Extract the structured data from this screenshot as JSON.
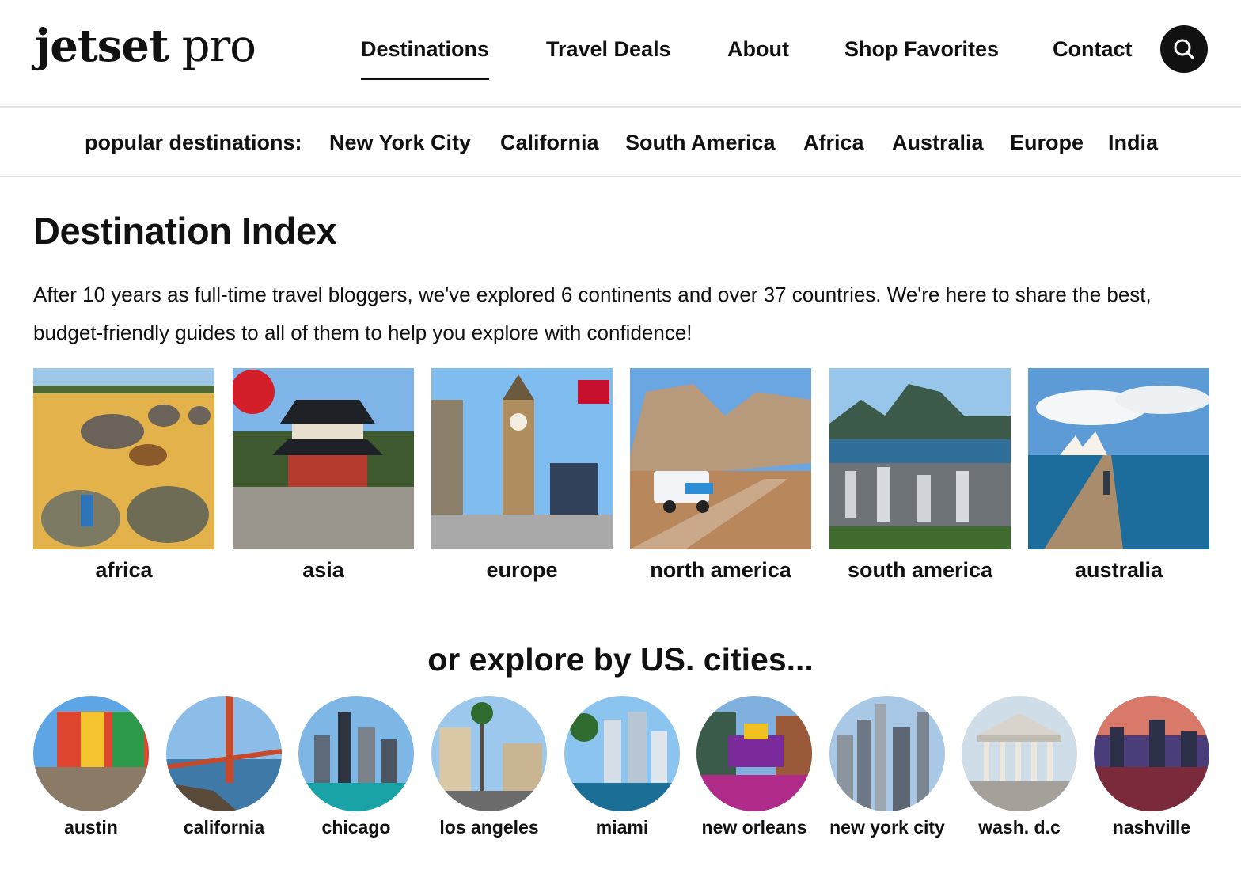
{
  "logo": {
    "part1": "jetset",
    "part2": "pro"
  },
  "nav": {
    "items": [
      {
        "label": "Destinations",
        "active": true
      },
      {
        "label": "Travel Deals"
      },
      {
        "label": "About"
      },
      {
        "label": "Shop Favorites"
      },
      {
        "label": "Contact"
      }
    ],
    "search_icon": "search-icon"
  },
  "popular": {
    "label": "popular destinations:",
    "links": [
      "New York City",
      "California",
      "South America",
      "Africa",
      "Australia",
      "Europe",
      "India"
    ]
  },
  "main": {
    "title": "Destination Index",
    "intro": "After 10 years as full-time travel bloggers, we've explored 6 continents and over 37 countries. We're here to share the best, budget-friendly guides to all of them to help you explore with confidence!",
    "continents": [
      {
        "label": "africa"
      },
      {
        "label": "asia"
      },
      {
        "label": "europe"
      },
      {
        "label": "north america"
      },
      {
        "label": "south america"
      },
      {
        "label": "australia"
      }
    ],
    "cities_title": "or explore by US. cities...",
    "cities": [
      {
        "label": "austin"
      },
      {
        "label": "california"
      },
      {
        "label": "chicago"
      },
      {
        "label": "los angeles"
      },
      {
        "label": "miami"
      },
      {
        "label": "new orleans"
      },
      {
        "label": "new york city"
      },
      {
        "label": "wash. d.c"
      },
      {
        "label": "nashville"
      }
    ]
  },
  "colors": {
    "text": "#111111",
    "divider": "#e3e3e3",
    "search_bg": "#111111"
  }
}
